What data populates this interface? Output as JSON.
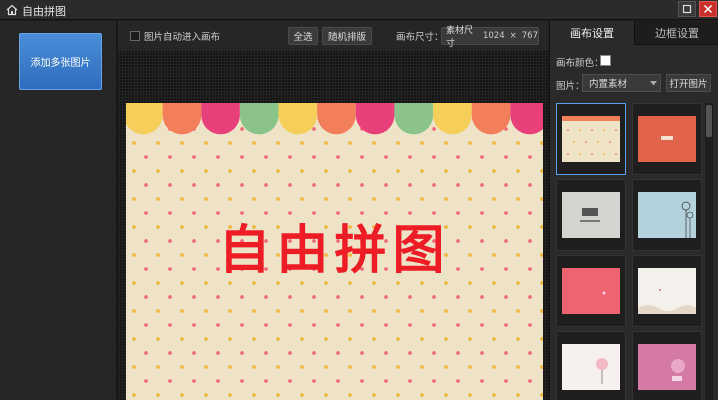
{
  "window": {
    "title": "自由拼图",
    "icons": {
      "app": "home-icon",
      "minimize": "minimize-icon",
      "close": "close-icon"
    }
  },
  "left_panel": {
    "add_button_label": "添加多张图片"
  },
  "toolbar": {
    "auto_enter_label": "图片自动进入画布",
    "auto_enter_checked": false,
    "select_all_label": "全选",
    "random_layout_label": "随机排版",
    "canvas_size_label": "画布尺寸：",
    "size_value_label": "素材尺寸",
    "size_width": "1024",
    "size_times": "×",
    "size_height": "767"
  },
  "canvas": {
    "title_text": "自由拼图",
    "colors": {
      "background": "#efe3c7",
      "title": "#ee1c24",
      "scallops": [
        "#f6cf5a",
        "#f27e5a",
        "#e8407a",
        "#8ac48a",
        "#f6cf5a",
        "#f27e5a",
        "#e8407a",
        "#8ac48a",
        "#f6cf5a",
        "#f27e5a",
        "#e8407a"
      ]
    }
  },
  "right_panel": {
    "tabs": [
      {
        "label": "画布设置",
        "active": true
      },
      {
        "label": "边框设置",
        "active": false
      }
    ],
    "canvas_color_label": "画布颜色：",
    "canvas_color_value": "#ffffff",
    "image_label": "图片：",
    "image_source_selected": "内置素材",
    "open_file_label": "打开图片",
    "thumbnails": [
      {
        "style": "polka-cream",
        "selected": true
      },
      {
        "style": "coral-plain",
        "selected": false
      },
      {
        "style": "grey-cartoon",
        "selected": false
      },
      {
        "style": "blue-dandelion",
        "selected": false
      },
      {
        "style": "pink-plain",
        "selected": false
      },
      {
        "style": "white-floral",
        "selected": false
      },
      {
        "style": "white-tree",
        "selected": false
      },
      {
        "style": "pink-tree",
        "selected": false
      }
    ]
  }
}
